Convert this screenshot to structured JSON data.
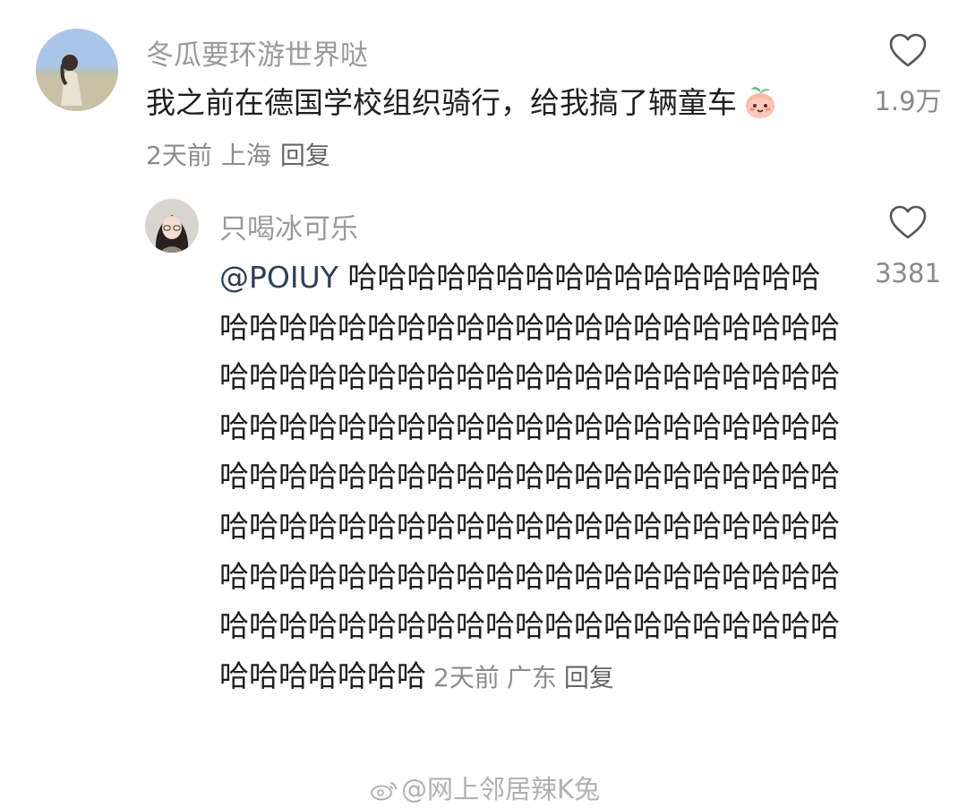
{
  "comment": {
    "username": "冬瓜要环游世界哒",
    "text": "我之前在德国学校组织骑行，给我搞了辆童车",
    "emoji": "peach-face-emoji",
    "time": "2天前",
    "location": "上海",
    "reply_label": "回复",
    "likes": "1.9万"
  },
  "reply": {
    "username": "只喝冰可乐",
    "mention": "@POIUY",
    "text": "哈哈哈哈哈哈哈哈哈哈哈哈哈哈哈哈哈哈哈哈哈哈哈哈哈哈哈哈哈哈哈哈哈哈哈哈哈哈哈哈哈哈哈哈哈哈哈哈哈哈哈哈哈哈哈哈哈哈哈哈哈哈哈哈哈哈哈哈哈哈哈哈哈哈哈哈哈哈哈哈哈哈哈哈哈哈哈哈哈哈哈哈哈哈哈哈哈哈哈哈哈哈哈哈哈哈哈哈哈哈哈哈哈哈哈哈哈哈哈哈哈哈哈哈哈哈哈哈哈哈哈哈哈哈哈哈哈哈哈哈哈哈哈哈哈哈哈哈哈哈哈哈哈哈哈哈哈哈哈哈哈哈哈哈哈哈哈哈哈哈",
    "time": "2天前",
    "location": "广东",
    "reply_label": "回复",
    "likes": "3381"
  },
  "watermark": "@网上邻居辣K兔",
  "colors": {
    "username": "#9a9a9a",
    "text": "#1f1f1f",
    "meta": "#8c8c8c",
    "mention": "#2d3f57"
  }
}
